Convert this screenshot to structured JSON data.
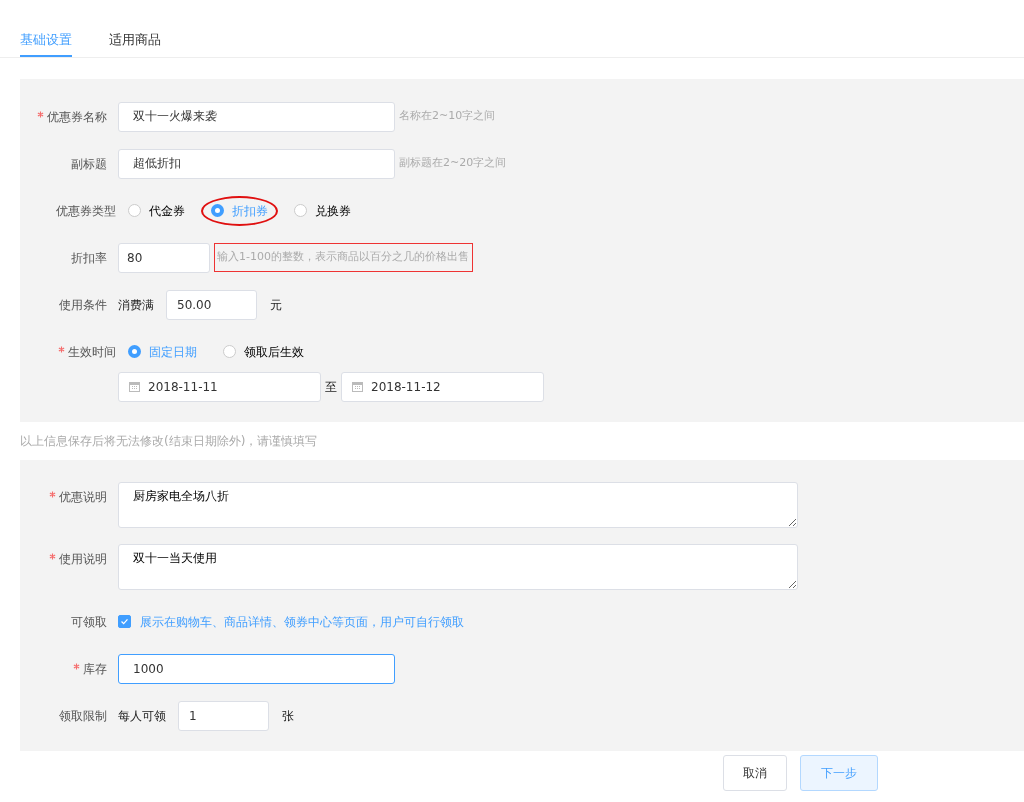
{
  "tabs": [
    {
      "label": "基础设置",
      "selected": true
    },
    {
      "label": "适用商品",
      "selected": false
    }
  ],
  "section_1": {
    "fields": [
      {
        "kind": "text",
        "label": "优惠券名称",
        "required": true,
        "value": "双十一火爆来袭",
        "hint": "名称在2~10字之间"
      },
      {
        "kind": "text",
        "label": "副标题",
        "required": false,
        "value": "超低折扣",
        "hint": "副标题在2~20字之间"
      },
      {
        "kind": "radio",
        "label": "优惠券类型",
        "required": false,
        "options": [
          {
            "label": "代金券",
            "selected": false,
            "circled": false
          },
          {
            "label": "折扣券",
            "selected": true,
            "circled": true
          },
          {
            "label": "兑换券",
            "selected": false,
            "circled": false
          }
        ]
      },
      {
        "kind": "short",
        "label": "折扣率",
        "required": false,
        "value": "80",
        "hint": "输入1-100的整数，表示商品以百分之几的价格出售",
        "hint_boxed": true
      },
      {
        "kind": "amount",
        "label": "使用条件",
        "required": false,
        "prefix": "消费满",
        "value": "50.00",
        "suffix": "元"
      },
      {
        "kind": "radio",
        "label": "生效时间",
        "required": true,
        "options": [
          {
            "label": "固定日期",
            "selected": true,
            "circled": false
          },
          {
            "label": "领取后生效",
            "selected": false,
            "circled": false
          }
        ],
        "dates": {
          "start": "2018-11-11",
          "separator": "至",
          "end": "2018-11-12"
        }
      }
    ]
  },
  "notice": "以上信息保存后将无法修改(结束日期除外)，请谨慎填写",
  "section_2": {
    "fields": [
      {
        "kind": "textarea",
        "label": "优惠说明",
        "required": true,
        "value": "厨房家电全场八折"
      },
      {
        "kind": "textarea",
        "label": "使用说明",
        "required": true,
        "value": "双十一当天使用"
      },
      {
        "kind": "checkbox",
        "label": "可领取",
        "required": false,
        "checked": true,
        "text": "展示在购物车、商品详情、领券中心等页面，用户可自行领取"
      },
      {
        "kind": "text",
        "label": "库存",
        "required": true,
        "value": "1000",
        "focused": true
      },
      {
        "kind": "amount",
        "label": "领取限制",
        "required": false,
        "prefix": "每人可领",
        "value": "1",
        "suffix": "张"
      }
    ]
  },
  "buttons": [
    {
      "label": "取消",
      "kind": "default"
    },
    {
      "label": "下一步",
      "kind": "primary"
    }
  ]
}
